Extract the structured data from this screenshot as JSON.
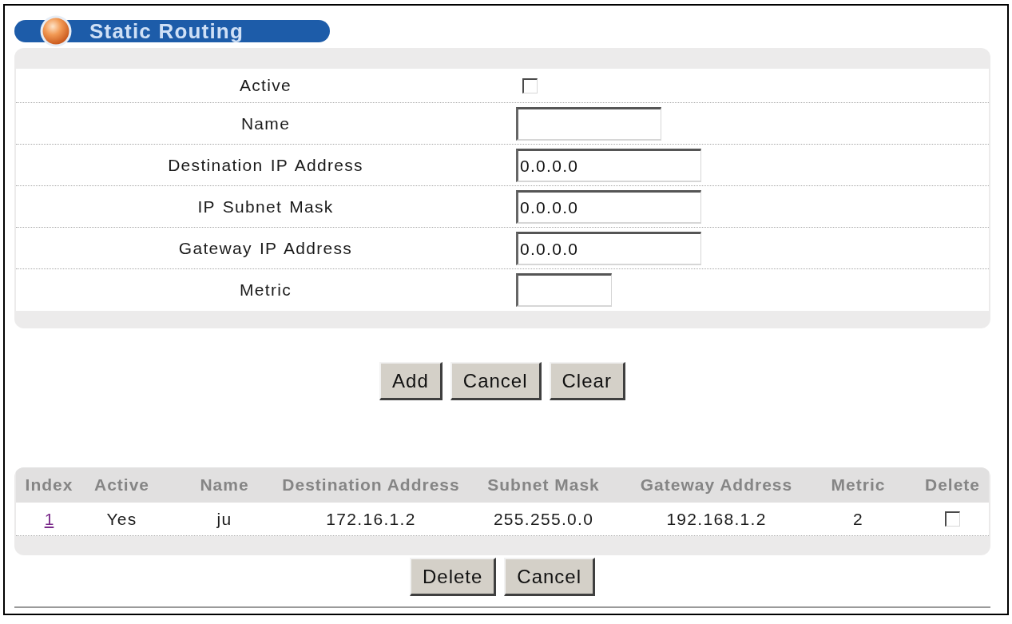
{
  "page": {
    "title": "Static Routing"
  },
  "form": {
    "fields": [
      {
        "label": "Active",
        "kind": "checkbox",
        "checked": false
      },
      {
        "label": "Name",
        "kind": "text"
      },
      {
        "label": "Destination IP Address",
        "kind": "ip",
        "value": "0.0.0.0"
      },
      {
        "label": "IP Subnet Mask",
        "kind": "ip",
        "value": "0.0.0.0"
      },
      {
        "label": "Gateway IP Address",
        "kind": "ip",
        "value": "0.0.0.0"
      },
      {
        "label": "Metric",
        "kind": "number"
      }
    ],
    "buttons": [
      "Add",
      "Cancel",
      "Clear"
    ]
  },
  "routes": {
    "columns": [
      "Index",
      "Active",
      "Name",
      "Destination Address",
      "Subnet Mask",
      "Gateway Address",
      "Metric",
      "Delete"
    ],
    "rows": [
      {
        "cells": [
          "1",
          "Yes",
          "ju",
          "172.16.1.2",
          "255.255.0.0",
          "192.168.1.2",
          "2"
        ],
        "checked": false
      }
    ],
    "buttons": [
      "Delete",
      "Cancel"
    ]
  }
}
